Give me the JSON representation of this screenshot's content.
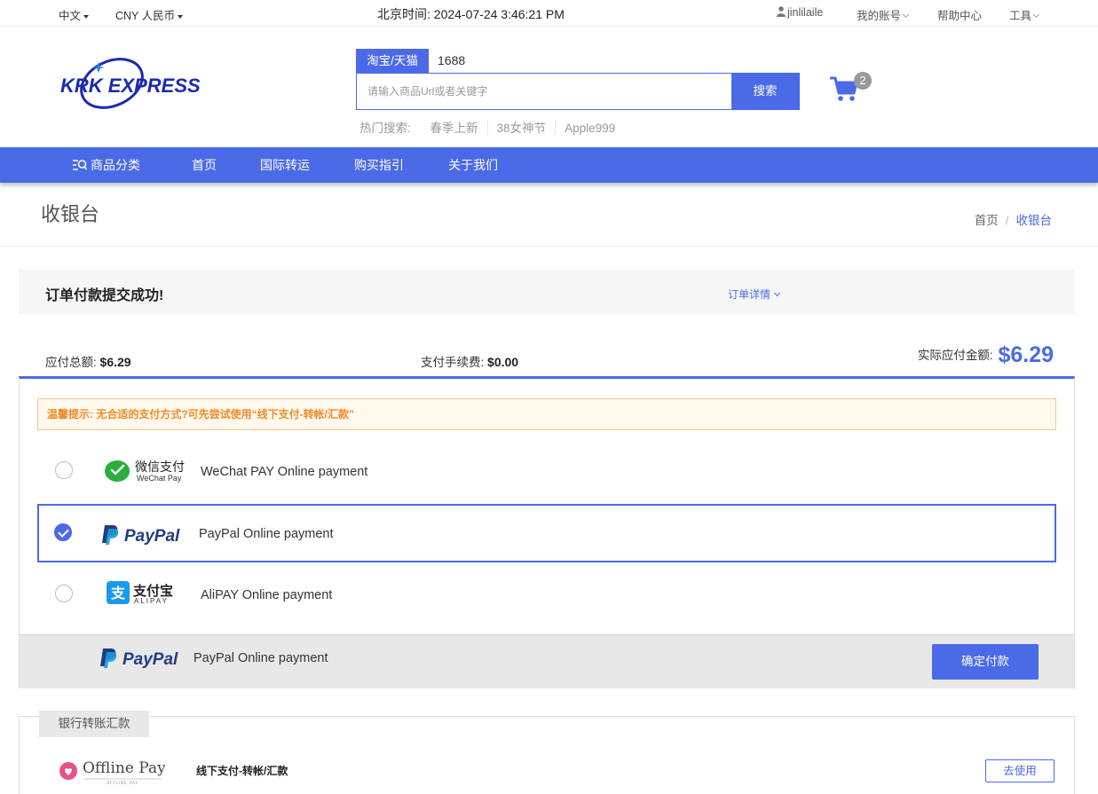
{
  "topbar": {
    "language": "中文",
    "currency": "CNY 人民币",
    "clock_label": "北京时间:",
    "clock_value": "2024-07-24 3:46:21 PM",
    "username": "jinlilaile",
    "account": "我的账号",
    "help": "帮助中心",
    "tools": "工具"
  },
  "header": {
    "logo_text": "KRK EXPRESS",
    "search_tabs": [
      "淘宝/天猫",
      "1688"
    ],
    "search_placeholder": "请输入商品Url或者关键字",
    "search_button": "搜索",
    "hot_label": "热门搜索:",
    "hot_items": [
      "春季上新",
      "38女神节",
      "Apple999"
    ],
    "cart_count": "2"
  },
  "nav": {
    "items": [
      "商品分类",
      "首页",
      "国际转运",
      "购买指引",
      "关于我们"
    ]
  },
  "page": {
    "title": "收银台",
    "breadcrumb": [
      "首页",
      "收银台"
    ]
  },
  "order": {
    "success_msg": "订单付款提交成功!",
    "detail_link": "订单详情",
    "total_label": "应付总额:",
    "total_value": "$6.29",
    "fee_label": "支付手续费:",
    "fee_value": "$0.00",
    "actual_label": "实际应付金额:",
    "actual_value": "$6.29"
  },
  "payment": {
    "tip": "温馨提示: 无合适的支付方式?可先尝试使用“线下支付-转帐/汇款”",
    "methods": [
      {
        "logo": "微信支付",
        "logo_sub": "WeChat Pay",
        "label": "WeChat PAY Online payment",
        "selected": false
      },
      {
        "logo": "PayPal",
        "label": "PayPal Online payment",
        "selected": true
      },
      {
        "logo": "支付宝",
        "logo_sub": "ALIPAY",
        "label": "AliPAY Online payment",
        "selected": false
      }
    ],
    "footer_logo": "PayPal",
    "footer_label": "PayPal Online payment",
    "confirm_button": "确定付款"
  },
  "bank": {
    "tab": "银行转账汇款",
    "logo_text": "Offline Pay",
    "logo_sub": "OFFLINE PAY",
    "label": "线下支付-转帐/汇款",
    "use_button": "去使用"
  },
  "colors": {
    "accent": "#4a6ae8",
    "tip_text": "#f08c2a",
    "tip_bg": "#fff8ec",
    "wechat_green": "#2aae3c",
    "alipay_blue": "#1a9be8",
    "paypal_dark": "#253b80",
    "paypal_light": "#179bd7"
  }
}
